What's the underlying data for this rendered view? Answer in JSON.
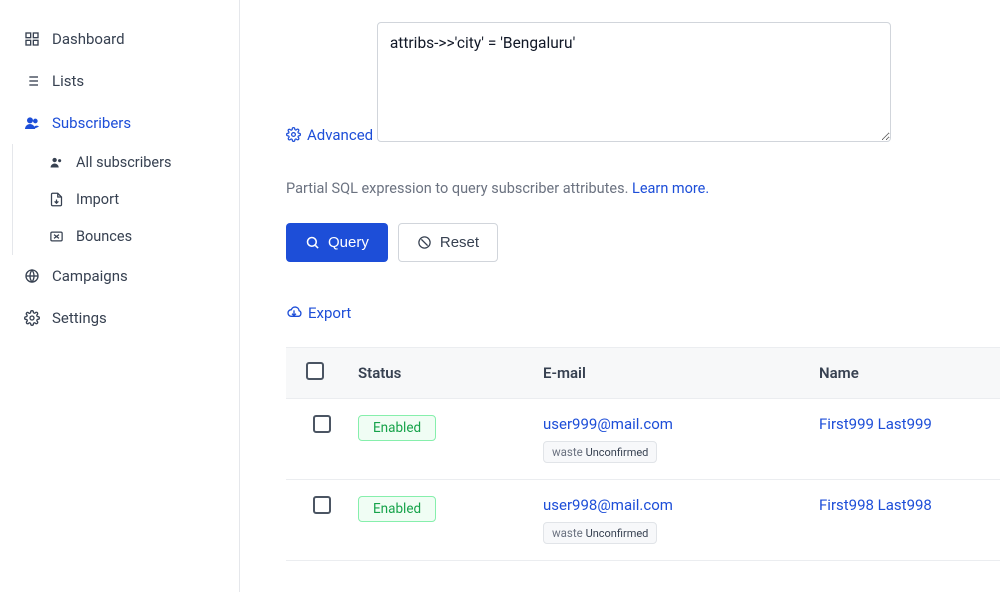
{
  "sidebar": {
    "dashboard": "Dashboard",
    "lists": "Lists",
    "subscribers": "Subscribers",
    "all_subscribers": "All subscribers",
    "import": "Import",
    "bounces": "Bounces",
    "campaigns": "Campaigns",
    "settings": "Settings"
  },
  "query": {
    "advanced_label": "Advanced",
    "expression": "attribs->>'city' = 'Bengaluru'",
    "hint_text": "Partial SQL expression to query subscriber attributes. ",
    "learn_more": "Learn more.",
    "query_btn": "Query",
    "reset_btn": "Reset",
    "export_label": "Export"
  },
  "table": {
    "headers": {
      "status": "Status",
      "email": "E-mail",
      "name": "Name"
    },
    "rows": [
      {
        "status": "Enabled",
        "email": "user999@mail.com",
        "name": "First999 Last999",
        "tag": "waste",
        "substatus": "Unconfirmed"
      },
      {
        "status": "Enabled",
        "email": "user998@mail.com",
        "name": "First998 Last998",
        "tag": "waste",
        "substatus": "Unconfirmed"
      }
    ]
  }
}
